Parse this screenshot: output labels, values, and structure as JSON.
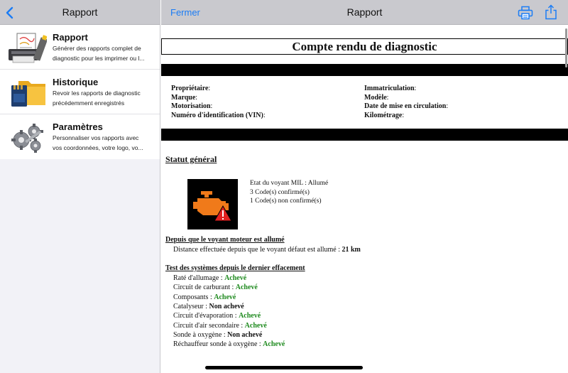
{
  "left": {
    "back_icon": "chevron-left-icon",
    "title": "Rapport",
    "items": [
      {
        "title": "Rapport",
        "desc_line1": "Générer des rapports complet de",
        "desc_line2": "diagnostic pour les imprimer ou l...",
        "icon": "printer-report-icon"
      },
      {
        "title": "Historique",
        "desc_line1": "Revoir les rapports de diagnostic",
        "desc_line2": "précédemment enregistrés",
        "icon": "folder-sdcard-icon"
      },
      {
        "title": "Paramètres",
        "desc_line1": "Personnaliser vos rapports avec",
        "desc_line2": "vos coordonnées, votre logo, vo...",
        "icon": "gears-icon"
      }
    ]
  },
  "right": {
    "close_label": "Fermer",
    "title": "Rapport",
    "print_icon": "printer-icon",
    "share_icon": "share-icon"
  },
  "doc": {
    "title": "Compte rendu de diagnostic",
    "info_left": [
      {
        "label": "Propriétaire",
        "sep": ":"
      },
      {
        "label": "Marque",
        "sep": ":"
      },
      {
        "label": "Motorisation",
        "sep": ":"
      },
      {
        "label": "Numéro d'identification (VIN)",
        "sep": ":"
      }
    ],
    "info_right": [
      {
        "label": "Immatriculation",
        "sep": ":"
      },
      {
        "label": "Modèle",
        "sep": ":"
      },
      {
        "label": "Date de mise en circulation",
        "sep": ":"
      },
      {
        "label": "Kilométrage",
        "sep": ":"
      }
    ],
    "status_title": "Statut général",
    "engine_icon": "check-engine-warning-icon",
    "mil_state": "Etat du voyant MIL : Allumé",
    "confirmed_codes": "3 Code(s) confirmé(s)",
    "unconfirmed_codes": "1 Code(s) non confirmé(s)",
    "since_mil_title": "Depuis que le voyant moteur est allumé",
    "distance_label": "Distance effectuée depuis que le voyant défaut est allumé : ",
    "distance_value": "21 km",
    "tests_title": "Test des systèmes depuis le dernier effacement",
    "tests": [
      {
        "label": "Raté d'allumage : ",
        "status": "Achevé",
        "done": true
      },
      {
        "label": "Circuit de carburant : ",
        "status": "Achevé",
        "done": true
      },
      {
        "label": "Composants : ",
        "status": "Achevé",
        "done": true
      },
      {
        "label": "Catalyseur : ",
        "status": "Non achevé",
        "done": false
      },
      {
        "label": "Circuit d'évaporation : ",
        "status": "Achevé",
        "done": true
      },
      {
        "label": "Circuit d'air secondaire : ",
        "status": "Achevé",
        "done": true
      },
      {
        "label": "Sonde à oxygène : ",
        "status": "Non achevé",
        "done": false
      },
      {
        "label": "Réchauffeur sonde à oxygène : ",
        "status": "Achevé",
        "done": true
      }
    ]
  },
  "colors": {
    "accent": "#1a7cf5",
    "done": "#1e8a1e",
    "engine_orange": "#f07a1a",
    "warning_red": "#e02020"
  }
}
